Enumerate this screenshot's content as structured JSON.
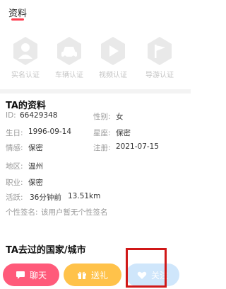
{
  "header": {
    "tab_title": "资料"
  },
  "certifications": [
    {
      "label": "实名认证",
      "icon": "person-hexagon-icon"
    },
    {
      "label": "车辆认证",
      "icon": "car-hexagon-icon"
    },
    {
      "label": "视频认证",
      "icon": "play-hexagon-icon"
    },
    {
      "label": "导游认证",
      "icon": "flag-hexagon-icon"
    }
  ],
  "profile": {
    "section_title": "TA的资料",
    "id_label": "ID:",
    "id_value": "66429348",
    "gender_label": "性别:",
    "gender_value": "女",
    "birthday_label": "生日:",
    "birthday_value": "1996-09-14",
    "zodiac_label": "星座:",
    "zodiac_value": "保密",
    "relationship_label": "情感:",
    "relationship_value": "保密",
    "registered_label": "注册:",
    "registered_value": "2021-07-15",
    "region_label": "地区:",
    "region_value": "温州",
    "job_label": "职业:",
    "job_value": "保密",
    "active_label": "活跃:",
    "active_time": "36分钟前",
    "active_distance": "13.51km",
    "signature_label": "个性签名:",
    "signature_value": "该用户暂无个性签名"
  },
  "countries": {
    "section_title": "TA去过的国家/城市"
  },
  "actions": {
    "chat_label": "聊天",
    "gift_label": "送礼",
    "follow_label": "关注"
  },
  "colors": {
    "accent": "#ff3b4d",
    "chat": "#ff5a7a",
    "gift": "#ffc24a",
    "follow": "#cfe6fb",
    "highlight": "#d01818"
  }
}
